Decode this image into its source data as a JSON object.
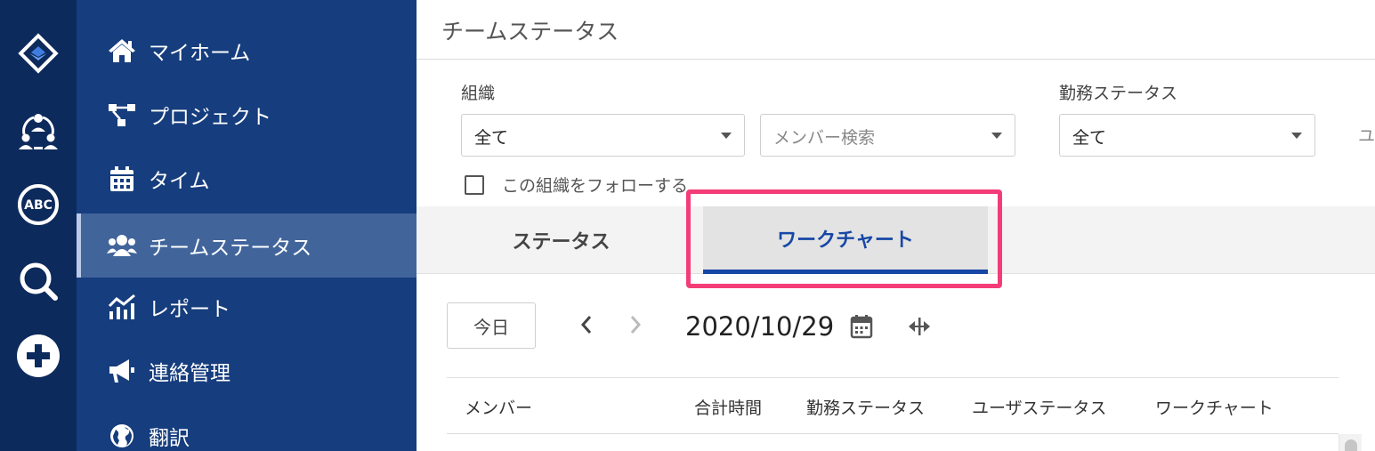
{
  "rail": {
    "icons": [
      "app-logo-icon",
      "team-icon",
      "abc-icon",
      "search-icon",
      "plus-icon"
    ]
  },
  "sidebar": {
    "items": [
      {
        "label": "マイホーム",
        "icon": "home-icon"
      },
      {
        "label": "プロジェクト",
        "icon": "project-icon"
      },
      {
        "label": "タイム",
        "icon": "calendar-icon"
      },
      {
        "label": "チームステータス",
        "icon": "users-icon",
        "active": true
      },
      {
        "label": "レポート",
        "icon": "chart-icon"
      },
      {
        "label": "連絡管理",
        "icon": "megaphone-icon"
      },
      {
        "label": "翻訳",
        "icon": "globe-icon"
      }
    ]
  },
  "page": {
    "title": "チームステータス"
  },
  "filters": {
    "org_label": "組織",
    "org_value": "全て",
    "member_placeholder": "メンバー検索",
    "work_status_label": "勤務ステータス",
    "work_status_value": "全て",
    "cut_label": "ユ",
    "follow_label": "この組織をフォローする"
  },
  "tabs": [
    {
      "label": "ステータス",
      "active": false
    },
    {
      "label": "ワークチャート",
      "active": true
    }
  ],
  "toolbar": {
    "today_label": "今日",
    "date": "2020/10/29"
  },
  "table": {
    "headers": [
      "メンバー",
      "合計時間",
      "勤務ステータス",
      "ユーザステータス",
      "ワークチャート"
    ]
  },
  "colors": {
    "rail_bg": "#0d2a5c",
    "sidebar_bg": "#163d7d",
    "sidebar_active": "#41659b",
    "accent": "#1747a6",
    "highlight": "#f43d78"
  }
}
